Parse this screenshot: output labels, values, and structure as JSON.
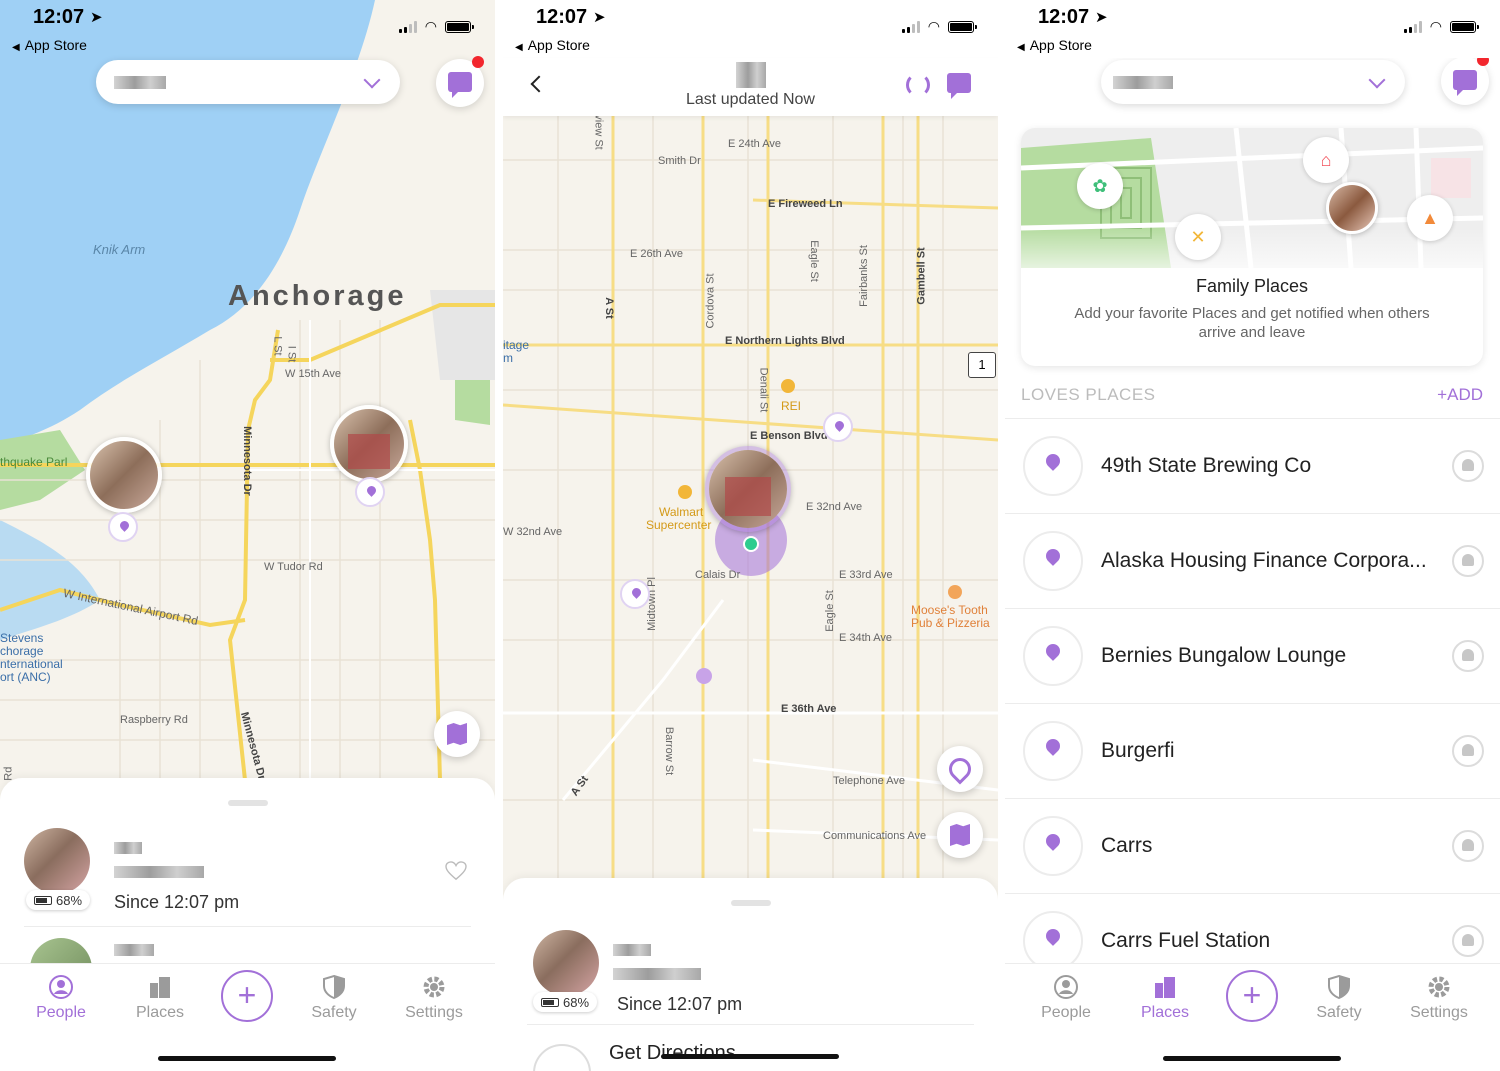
{
  "status_bar": {
    "time": "12:07",
    "back_label": "App Store"
  },
  "screen1": {
    "map_labels": {
      "city": "Anchorage",
      "water": "Knik Arm",
      "park": "thquake Parl",
      "st_15th": "W 15th Ave",
      "st_l": "L St",
      "st_i": "I St",
      "minnesota_dr": "Minnesota Dr",
      "tudor": "W Tudor Rd",
      "intl_airport": "W International Airport Rd",
      "raspberry": "Raspberry Rd",
      "minnesota_dr2": "Minnesota Dr",
      "airport_line1": "Stevens",
      "airport_line2": "chorage",
      "airport_line3": "nternational",
      "airport_line4": "ort (ANC)",
      "ve_rd": "ve Rd"
    },
    "member": {
      "battery": "68%",
      "since": "Since 12:07 pm"
    }
  },
  "screen2": {
    "nav": {
      "last_updated": "Last updated Now"
    },
    "map_labels": {
      "e24th": "E 24th Ave",
      "smith": "Smith Dr",
      "fireweed": "E Fireweed Ln",
      "e26th": "E 26th Ave",
      "cordova": "Cordova St",
      "eagle": "Eagle St",
      "fairbanks": "Fairbanks St",
      "gambell": "Gambell St",
      "a_st": "A St",
      "itage": "itage",
      "m": "m",
      "northern_lights": "E Northern Lights Blvd",
      "denali": "Denali St",
      "rei": "REI",
      "benson": "E Benson Blvd",
      "walmart1": "Walmart",
      "walmart2": "Supercenter",
      "e32nd": "E 32nd Ave",
      "w32nd": "W 32nd Ave",
      "calais": "Calais Dr",
      "e33rd": "E 33rd Ave",
      "midtown": "Midtown Pl",
      "eagle2": "Eagle St",
      "mooses1": "Moose's Tooth",
      "mooses2": "Pub & Pizzeria",
      "e34th": "E 34th Ave",
      "e36th": "E 36th Ave",
      "barrow": "Barrow St",
      "a_st2": "A St",
      "telephone": "Telephone Ave",
      "communications": "Communications Ave",
      "view_st": "view St"
    },
    "member": {
      "battery": "68%",
      "since": "Since 12:07 pm"
    },
    "directions": "Get Directions"
  },
  "screen3": {
    "family_places": {
      "title": "Family Places",
      "text": "Add your favorite Places and get notified when others arrive and leave"
    },
    "section_title": "LOVES PLACES",
    "add_label": "+ADD",
    "places": [
      {
        "name": "49th State Brewing Co"
      },
      {
        "name": "Alaska Housing Finance Corpora..."
      },
      {
        "name": "Bernies Bungalow Lounge"
      },
      {
        "name": "Burgerfi"
      },
      {
        "name": "Carrs"
      },
      {
        "name": "Carrs Fuel Station"
      }
    ]
  },
  "tabs": [
    {
      "label": "People",
      "icon": "person-icon"
    },
    {
      "label": "Places",
      "icon": "buildings-icon"
    },
    {
      "label": "Safety",
      "icon": "shield-icon"
    },
    {
      "label": "Settings",
      "icon": "gear-icon"
    }
  ],
  "colors": {
    "accent": "#a270d8",
    "notification": "#f2262d",
    "water": "#9fd0f5",
    "land": "#f6f3ec",
    "highway": "#f5d55c",
    "park": "#b5dca0"
  }
}
